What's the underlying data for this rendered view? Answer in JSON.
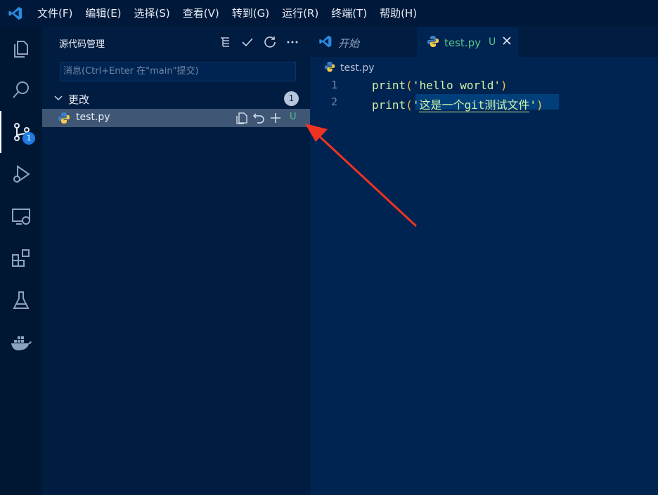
{
  "menu": {
    "items": [
      "文件(F)",
      "编辑(E)",
      "选择(S)",
      "查看(V)",
      "转到(G)",
      "运行(R)",
      "终端(T)",
      "帮助(H)"
    ]
  },
  "activity_bar": {
    "items": [
      "explorer-icon",
      "search-icon",
      "source-control-icon",
      "run-debug-icon",
      "remote-explorer-icon",
      "extensions-icon",
      "testing-icon",
      "docker-icon"
    ],
    "scm_badge": "1"
  },
  "sidebar": {
    "title": "源代码管理",
    "commit_message_placeholder": "消息(Ctrl+Enter 在\"main\"提交)",
    "changes_label": "更改",
    "changes_count": "1",
    "file": {
      "name": "test.py",
      "status": "U"
    }
  },
  "editor": {
    "tabs": [
      {
        "label": "开始"
      },
      {
        "label": "test.py",
        "status": "U"
      }
    ],
    "breadcrumb": "test.py",
    "lines": [
      {
        "num": "1",
        "fn": "print",
        "open": "(",
        "str": "'hello world'",
        "close": ")"
      },
      {
        "num": "2",
        "fn": "print",
        "open": "(",
        "q1": "'",
        "str": "这是一个git测试文件",
        "q2": "'",
        "close": ")"
      }
    ]
  },
  "colors": {
    "background": "#002451",
    "sidebar": "#001c40",
    "accent_green": "#57c48b",
    "badge_blue": "#1e7be0",
    "annotation_arrow": "#ee3322"
  }
}
